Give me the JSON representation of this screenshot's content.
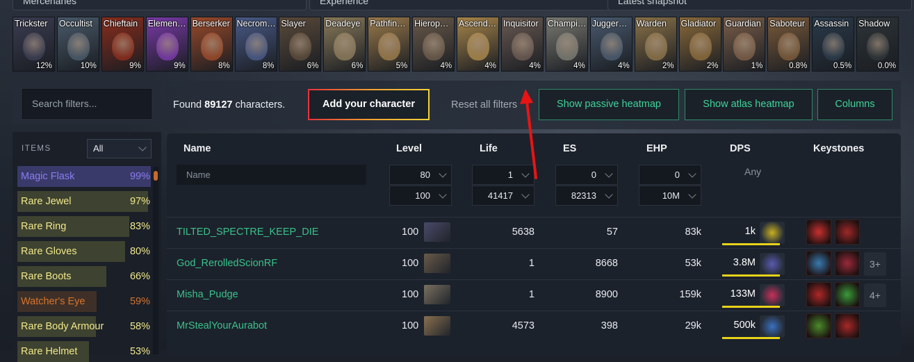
{
  "top_tabs": [
    "Mercenaries",
    "Experience",
    "Latest snapshot"
  ],
  "classes": [
    {
      "name": "Trickster",
      "pct": "12%",
      "color": "#3b3d52"
    },
    {
      "name": "Occultist",
      "pct": "10%",
      "color": "#4a5a6a"
    },
    {
      "name": "Chieftain",
      "pct": "9%",
      "color": "#8a2d1c"
    },
    {
      "name": "Elemen…",
      "pct": "9%",
      "color": "#7a3aa8"
    },
    {
      "name": "Berserker",
      "pct": "8%",
      "color": "#9a4a2a"
    },
    {
      "name": "Necrom…",
      "pct": "8%",
      "color": "#4a5a86"
    },
    {
      "name": "Slayer",
      "pct": "6%",
      "color": "#5a4a3a"
    },
    {
      "name": "Deadeye",
      "pct": "6%",
      "color": "#8a7a5a"
    },
    {
      "name": "Pathfin…",
      "pct": "5%",
      "color": "#9a7a4a"
    },
    {
      "name": "Hierop…",
      "pct": "4%",
      "color": "#6a5a4a"
    },
    {
      "name": "Ascend…",
      "pct": "4%",
      "color": "#a8864a"
    },
    {
      "name": "Inquisitor",
      "pct": "4%",
      "color": "#6a5a52"
    },
    {
      "name": "Champi…",
      "pct": "4%",
      "color": "#7a7a72"
    },
    {
      "name": "Jugger…",
      "pct": "4%",
      "color": "#4a5a6e"
    },
    {
      "name": "Warden",
      "pct": "2%",
      "color": "#8a7248"
    },
    {
      "name": "Gladiator",
      "pct": "2%",
      "color": "#8a6a3a"
    },
    {
      "name": "Guardian",
      "pct": "1%",
      "color": "#7a5e48"
    },
    {
      "name": "Saboteur",
      "pct": "0.8%",
      "color": "#7a5a3a"
    },
    {
      "name": "Assassin",
      "pct": "0.5%",
      "color": "#2a3a4a"
    },
    {
      "name": "Shadow",
      "pct": "0.0%",
      "color": "#2e3438"
    }
  ],
  "search_placeholder": "Search filters...",
  "found": {
    "prefix": "Found",
    "count": "89127",
    "suffix": "characters."
  },
  "buttons": {
    "add_character": "Add your character",
    "reset_filters": "Reset all filters",
    "passive_heatmap": "Show passive heatmap",
    "atlas_heatmap": "Show atlas heatmap",
    "columns": "Columns"
  },
  "items_panel": {
    "label": "ITEMS",
    "select_value": "All",
    "items": [
      {
        "name": "Magic Flask",
        "pct": "99%",
        "fill": 0.99,
        "color": "#8a7cf0",
        "bg": "#3a3a6a"
      },
      {
        "name": "Rare Jewel",
        "pct": "97%",
        "fill": 0.97,
        "color": "#f0e88a",
        "bg": "#3e4230"
      },
      {
        "name": "Rare Ring",
        "pct": "83%",
        "fill": 0.83,
        "color": "#f0e88a",
        "bg": "#3e4230"
      },
      {
        "name": "Rare Gloves",
        "pct": "80%",
        "fill": 0.8,
        "color": "#f0e88a",
        "bg": "#3e4230"
      },
      {
        "name": "Rare Boots",
        "pct": "66%",
        "fill": 0.66,
        "color": "#f0e88a",
        "bg": "#3e4230"
      },
      {
        "name": "Watcher's Eye",
        "pct": "59%",
        "fill": 0.59,
        "color": "#d8742a",
        "bg": "#3e3028"
      },
      {
        "name": "Rare Body Armour",
        "pct": "58%",
        "fill": 0.58,
        "color": "#f0e88a",
        "bg": "#3e4230"
      },
      {
        "name": "Rare Helmet",
        "pct": "53%",
        "fill": 0.53,
        "color": "#f0e88a",
        "bg": "#3e4230"
      }
    ]
  },
  "table": {
    "headers": {
      "name": "Name",
      "level": "Level",
      "life": "Life",
      "es": "ES",
      "ehp": "EHP",
      "dps": "DPS",
      "keystones": "Keystones"
    },
    "name_placeholder": "Name",
    "filters": {
      "level_min": "80",
      "level_max": "100",
      "life_min": "1",
      "life_max": "41417",
      "es_min": "0",
      "es_max": "82313",
      "ehp_min": "0",
      "ehp_max": "10M",
      "dps": "Any"
    },
    "rows": [
      {
        "name": "TILTED_SPECTRE_KEEP_DIE",
        "level": "100",
        "life": "5638",
        "es": "57",
        "ehp": "83k",
        "dps": "1k",
        "dps_fill": 0.92,
        "class_color": "#4a4a6a",
        "skill_color": "#c8b020",
        "keystones": [
          "#c83030",
          "#a02828"
        ],
        "more": ""
      },
      {
        "name": "God_RerolledScionRF",
        "level": "100",
        "life": "1",
        "es": "8668",
        "ehp": "53k",
        "dps": "3.8M",
        "dps_fill": 0.92,
        "class_color": "#6a5a4a",
        "skill_color": "#5a5ab0",
        "keystones": [
          "#3a7ab0",
          "#9a2a3a"
        ],
        "more": "3+"
      },
      {
        "name": "Misha_Pudge",
        "level": "100",
        "life": "1",
        "es": "8900",
        "ehp": "159k",
        "dps": "133M",
        "dps_fill": 0.92,
        "class_color": "#7a7060",
        "skill_color": "#c8305a",
        "keystones": [
          "#b02828",
          "#3a9a3a"
        ],
        "more": "4+"
      },
      {
        "name": "MrStealYourAurabot",
        "level": "100",
        "life": "4573",
        "es": "398",
        "ehp": "29k",
        "dps": "500k",
        "dps_fill": 0.92,
        "class_color": "#8a7050",
        "skill_color": "#3a70c0",
        "keystones": [
          "#4a8a2a",
          "#a82828"
        ],
        "more": ""
      }
    ]
  }
}
